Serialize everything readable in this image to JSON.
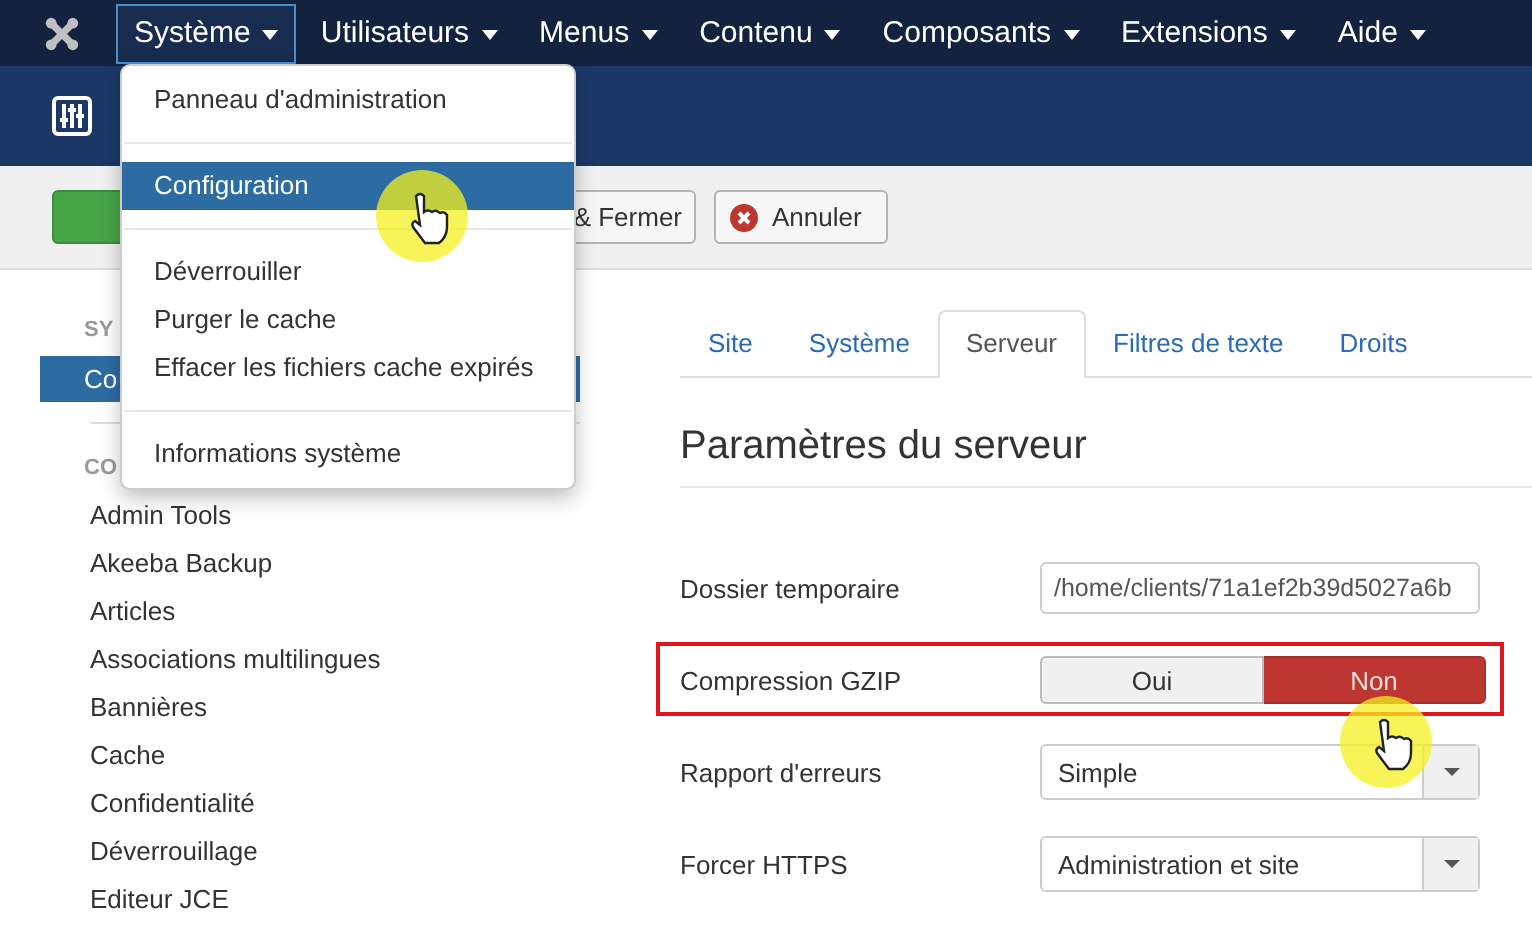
{
  "top_menu": {
    "items": [
      {
        "label": "Système",
        "selected": true
      },
      {
        "label": "Utilisateurs",
        "selected": false
      },
      {
        "label": "Menus",
        "selected": false
      },
      {
        "label": "Contenu",
        "selected": false
      },
      {
        "label": "Composants",
        "selected": false
      },
      {
        "label": "Extensions",
        "selected": false
      },
      {
        "label": "Aide",
        "selected": false
      }
    ]
  },
  "dropdown": {
    "items": [
      {
        "kind": "item",
        "label": "Panneau d'administration",
        "selected": false
      },
      {
        "kind": "divider"
      },
      {
        "kind": "item",
        "label": "Configuration",
        "selected": true
      },
      {
        "kind": "divider"
      },
      {
        "kind": "item",
        "label": "Déverrouiller",
        "selected": false
      },
      {
        "kind": "item",
        "label": "Purger le cache",
        "selected": false
      },
      {
        "kind": "item",
        "label": "Effacer les fichiers cache expirés",
        "selected": false
      },
      {
        "kind": "divider"
      },
      {
        "kind": "item",
        "label": "Informations système",
        "selected": false
      }
    ]
  },
  "toolbar": {
    "buttons": [
      {
        "kind": "save"
      },
      {
        "kind": "plain",
        "label": "& Fermer"
      },
      {
        "kind": "cancel",
        "label": "Annuler"
      }
    ]
  },
  "sidebar": {
    "sections": [
      {
        "heading": "SY",
        "items": [
          {
            "label": "Co",
            "selected": true
          }
        ]
      },
      {
        "heading": "CO",
        "items": [
          {
            "label": "Admin Tools",
            "selected": false
          },
          {
            "label": "Akeeba Backup",
            "selected": false
          },
          {
            "label": "Articles",
            "selected": false
          },
          {
            "label": "Associations multilingues",
            "selected": false
          },
          {
            "label": "Bannières",
            "selected": false
          },
          {
            "label": "Cache",
            "selected": false
          },
          {
            "label": "Confidentialité",
            "selected": false
          },
          {
            "label": "Déverrouillage",
            "selected": false
          },
          {
            "label": "Editeur JCE",
            "selected": false
          }
        ]
      }
    ]
  },
  "tabs": [
    {
      "label": "Site",
      "selected": false
    },
    {
      "label": "Système",
      "selected": false
    },
    {
      "label": "Serveur",
      "selected": true
    },
    {
      "label": "Filtres de texte",
      "selected": false
    },
    {
      "label": "Droits",
      "selected": false
    }
  ],
  "section_title": "Paramètres du serveur",
  "fields": [
    {
      "kind": "text",
      "label": "Dossier temporaire",
      "value": "/home/clients/71a1ef2b39d5027a6b",
      "highlighted": false
    },
    {
      "kind": "toggle",
      "label": "Compression GZIP",
      "options": [
        {
          "label": "Oui",
          "selected": false
        },
        {
          "label": "Non",
          "selected": true
        }
      ],
      "highlighted": true
    },
    {
      "kind": "select",
      "label": "Rapport d'erreurs",
      "value": "Simple",
      "highlighted": false
    },
    {
      "kind": "select",
      "label": "Forcer HTTPS",
      "value": "Administration et site",
      "highlighted": false
    }
  ]
}
